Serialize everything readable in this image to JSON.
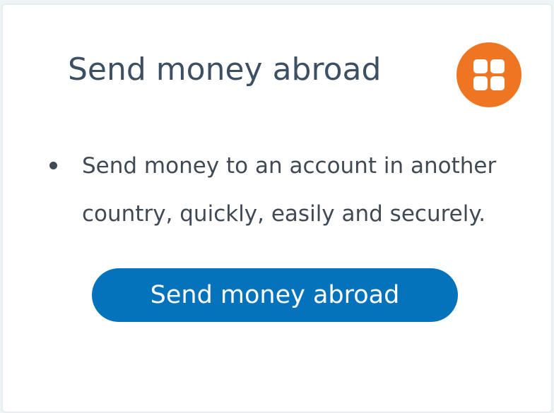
{
  "card": {
    "title": "Send money abroad",
    "icon": "four-squares-grid-icon",
    "bullets": [
      {
        "line1": "Send money to an account in another",
        "line2": "country, quickly, easily and securely."
      }
    ],
    "button_label": "Send money abroad"
  },
  "colors": {
    "accent_orange": "#ee7623",
    "button_blue": "#0573bc",
    "title_text": "#3d4f62",
    "body_text": "#3f4a55"
  }
}
